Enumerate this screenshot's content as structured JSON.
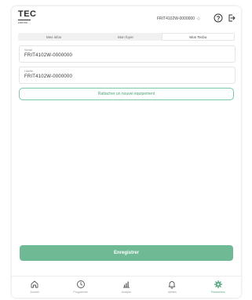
{
  "header": {
    "logo_main": "TEC",
    "logo_sub": "control",
    "device": "FRIT4102W-0000000"
  },
  "tabs": [
    {
      "label": "Mes infos",
      "active": false
    },
    {
      "label": "Mon foyer",
      "active": false
    },
    {
      "label": "Mon Tecbo",
      "active": true
    }
  ],
  "fields": {
    "serial": {
      "label": "Serial",
      "value": "FRIT4102W-0000000"
    },
    "libelle": {
      "label": "Libellé",
      "value": "FRIT4102W-0000000"
    }
  },
  "attach_button": "Rattacher un nouvel équipement",
  "save_button": "Enregistrer",
  "nav": [
    {
      "label": "Accueil",
      "icon": "home-icon",
      "active": false
    },
    {
      "label": "Programme",
      "icon": "clock-icon",
      "active": false
    },
    {
      "label": "Analyse",
      "icon": "bar-chart-icon",
      "active": false
    },
    {
      "label": "Alertes",
      "icon": "bell-icon",
      "active": false
    },
    {
      "label": "Paramètres",
      "icon": "gear-icon",
      "active": true
    }
  ],
  "colors": {
    "accent": "#6fb995",
    "accent_outline": "#7cc7a5"
  }
}
